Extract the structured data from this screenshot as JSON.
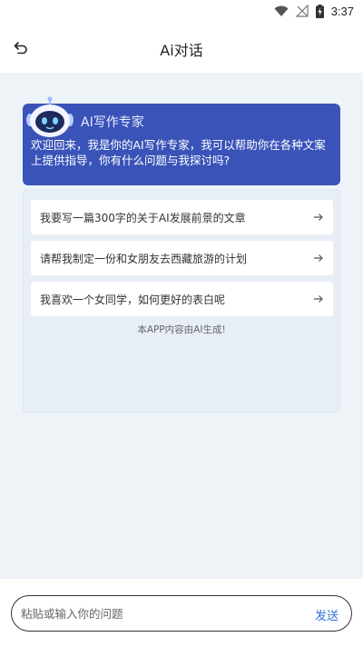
{
  "status_bar": {
    "time": "3:37"
  },
  "app_bar": {
    "title": "Ai对话"
  },
  "welcome": {
    "assistant_name": "AI写作专家",
    "message": "欢迎回来，我是你的AI写作专家，我可以帮助你在各种文案上提供指导，你有什么问题与我探讨吗?"
  },
  "suggestions": [
    {
      "text": "我要写一篇300字的关于AI发展前景的文章"
    },
    {
      "text": "请帮我制定一份和女朋友去西藏旅游的计划"
    },
    {
      "text": "我喜欢一个女同学，如何更好的表白呢"
    }
  ],
  "disclaimer": "本APP内容由AI生成!",
  "input": {
    "placeholder": "粘贴或输入你的问题",
    "value": ""
  },
  "send_label": "发送",
  "colors": {
    "accent": "#3a53b8",
    "background": "#eef3f8",
    "send": "#2f6fd6"
  }
}
